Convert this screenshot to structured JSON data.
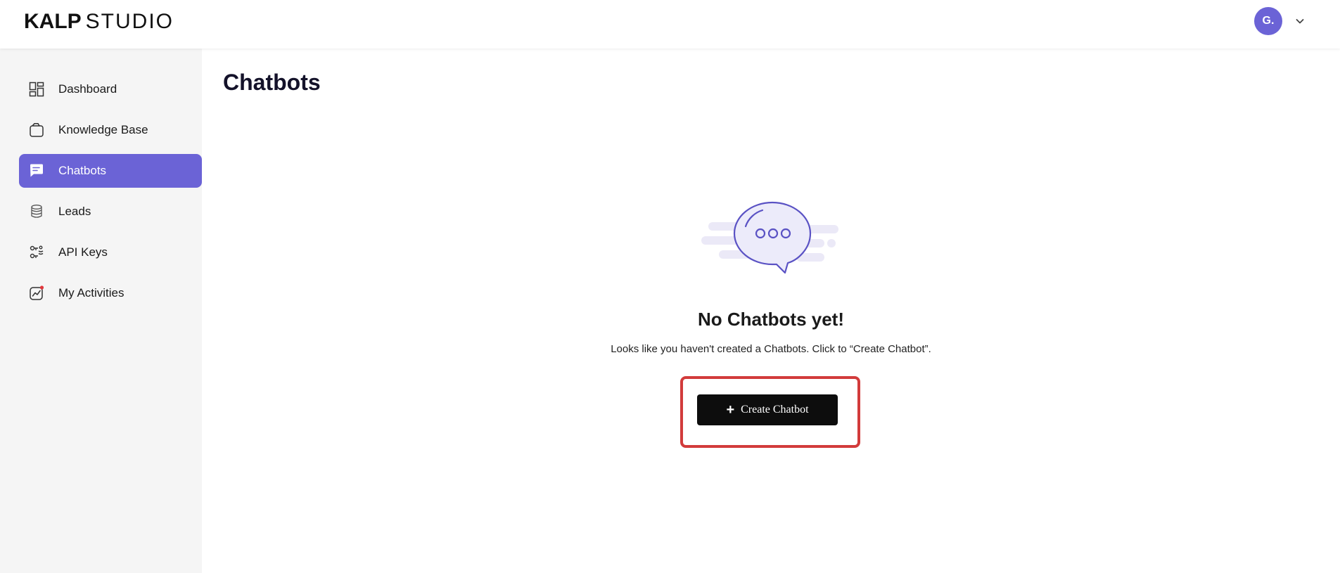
{
  "header": {
    "logo_brand": "KALP",
    "logo_product": "STUDIO",
    "avatar_initial": "G."
  },
  "sidebar": {
    "items": [
      {
        "label": "Dashboard",
        "icon": "dashboard-icon",
        "active": false
      },
      {
        "label": "Knowledge Base",
        "icon": "knowledge-base-icon",
        "active": false
      },
      {
        "label": "Chatbots",
        "icon": "chat-icon",
        "active": true
      },
      {
        "label": "Leads",
        "icon": "database-icon",
        "active": false
      },
      {
        "label": "API Keys",
        "icon": "api-keys-icon",
        "active": false
      },
      {
        "label": "My Activities",
        "icon": "activity-chart-icon",
        "active": false
      }
    ]
  },
  "main": {
    "title": "Chatbots",
    "empty_state": {
      "heading": "No Chatbots yet!",
      "description": "Looks like you haven't created a Chatbots. Click to “Create Chatbot”.",
      "button_label": "Create Chatbot"
    }
  },
  "colors": {
    "accent": "#6b63d6",
    "button": "#0d0d0d",
    "highlight": "#d23b3b",
    "sidebar_bg": "#f5f5f5"
  }
}
